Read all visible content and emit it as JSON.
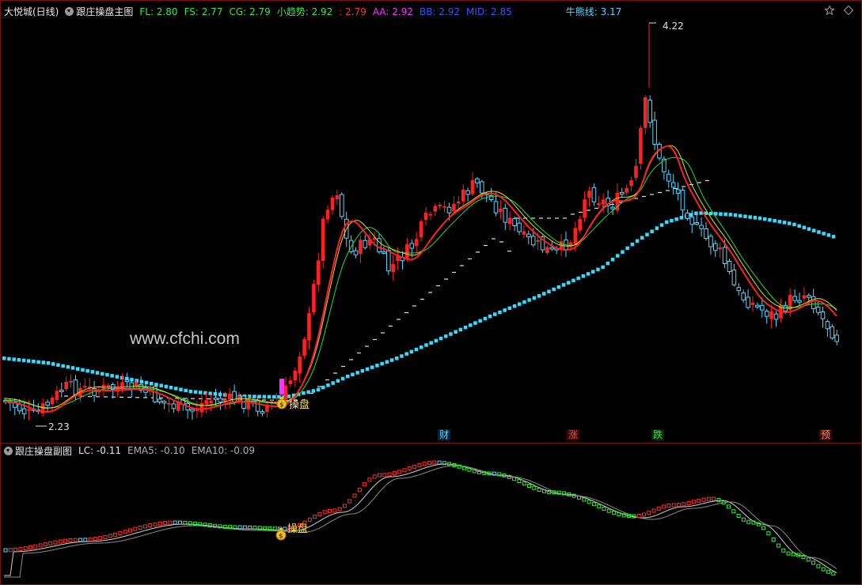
{
  "main": {
    "stock_name": "大悦城(日线)",
    "indicator_name": "跟庄操盘主图",
    "values": [
      {
        "label": "FL: 2.80",
        "color": "#39e64a"
      },
      {
        "label": "FS: 2.77",
        "color": "#39e64a"
      },
      {
        "label": "CG: 2.79",
        "color": "#39e64a"
      },
      {
        "label": "小趋势: 2.92",
        "color": "#39e64a"
      },
      {
        "label": ": 2.79",
        "color": "#ff3333"
      },
      {
        "label": "AA: 2.92",
        "color": "#ff33ff"
      },
      {
        "label": "BB: 2.92",
        "color": "#3355ff"
      },
      {
        "label": "MID: 2.85",
        "color": "#3355ff"
      }
    ],
    "bull_bear": {
      "label": "牛熊线: 3.17",
      "color": "#54d6ff"
    },
    "high_label": "4.22",
    "low_label": "2.23",
    "watermark": "www.cfchi.com",
    "caopan_label": "操盘",
    "markers": [
      {
        "text": "财",
        "color": "#54d6ff"
      },
      {
        "text": "涨",
        "color": "#ff4444"
      },
      {
        "text": "跌",
        "color": "#39e64a"
      },
      {
        "text": "预",
        "color": "#ff8844"
      }
    ],
    "icons": [
      "star-icon",
      "diamond-icon"
    ]
  },
  "sub": {
    "indicator_name": "跟庄操盘副图",
    "values": [
      {
        "label": "LC: -0.11",
        "color": "#e8e8e8"
      },
      {
        "label": "EMA5: -0.10",
        "color": "#b0b0b0"
      },
      {
        "label": "EMA10: -0.09",
        "color": "#b0b0b0"
      }
    ],
    "caopan_label": "操盘"
  },
  "colors": {
    "up": "#ff2020",
    "down": "#54d6ff",
    "bull_bear_line": "#33ddff",
    "border": "#7a1010"
  }
}
